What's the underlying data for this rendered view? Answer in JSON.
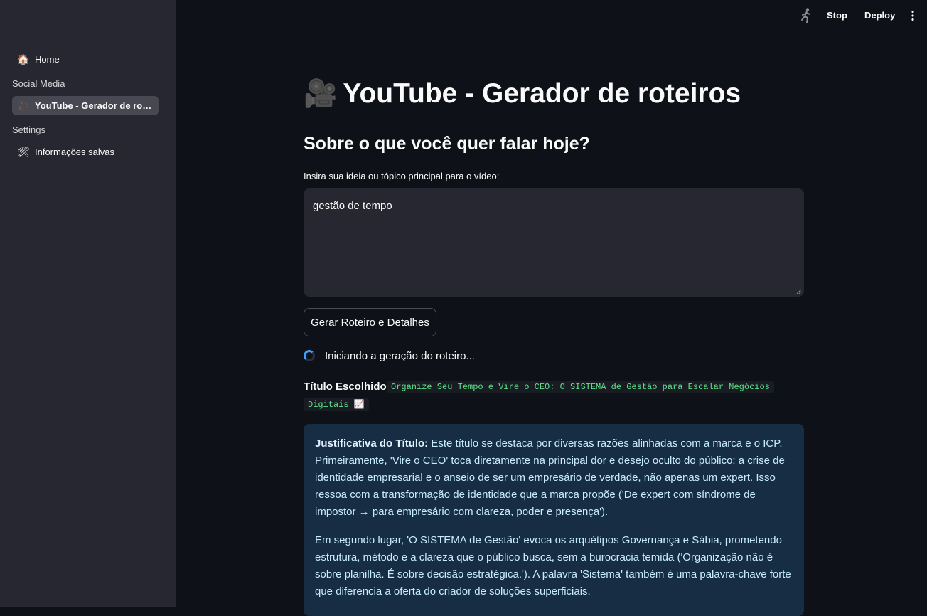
{
  "topbar": {
    "stop_label": "Stop",
    "deploy_label": "Deploy",
    "running_icon": "running-man-icon",
    "menu_icon": "more-vertical-icon"
  },
  "sidebar": {
    "home_label": "Home",
    "home_icon": "house-emoji",
    "section_social": "Social Media",
    "youtube_label": "YouTube - Gerador de roteiros",
    "youtube_icon": "movie-camera-emoji",
    "section_settings": "Settings",
    "saved_label": "Informações salvas",
    "saved_icon": "tools-emoji"
  },
  "main": {
    "title_icon": "movie-camera-emoji",
    "title": "YouTube - Gerador de roteiros",
    "subtitle": "Sobre o que você quer falar hoje?",
    "input_label": "Insira sua ideia ou tópico principal para o vídeo:",
    "input_value": "gestão de tempo",
    "generate_button": "Gerar Roteiro e Detalhes",
    "status": "Iniciando a geração do roteiro...",
    "chosen_title_label": "Título Escolhido:",
    "chosen_title_part1": "Organize Seu Tempo e Vire o CEO: O SISTEMA de Gestão para Escalar Negócios",
    "chosen_title_part2": "Digitais 📈",
    "justification_label": "Justificativa do Título:",
    "justification_p1": " Este título se destaca por diversas razões alinhadas com a marca e o ICP. Primeiramente, 'Vire o CEO' toca diretamente na principal dor e desejo oculto do público: a crise de identidade empresarial e o anseio de ser um empresário de verdade, não apenas um expert. Isso ressoa com a transformação de identidade que a marca propõe ('De expert com síndrome de impostor → para empresário com clareza, poder e presença').",
    "justification_p2": "Em segundo lugar, 'O SISTEMA de Gestão' evoca os arquétipos Governança e Sábia, prometendo estrutura, método e a clareza que o público busca, sem a burocracia temida ('Organização não é sobre planilha. É sobre decisão estratégica.'). A palavra 'Sistema' também é uma palavra-chave forte que diferencia a oferta do criador de soluções superficiais."
  }
}
